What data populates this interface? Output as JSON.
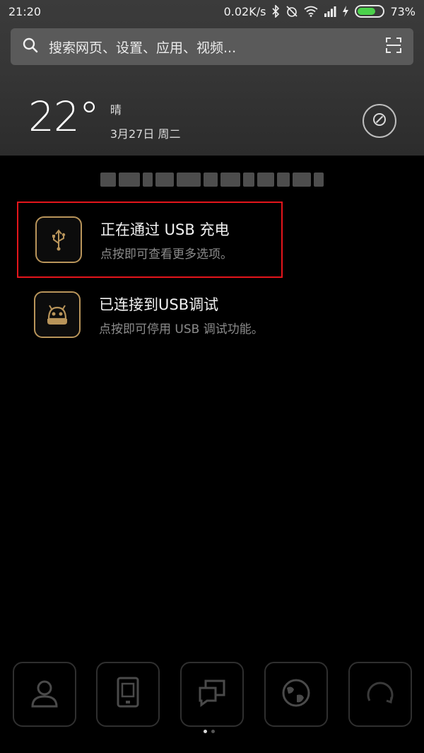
{
  "status_bar": {
    "time": "21:20",
    "speed": "0.02K/s",
    "battery": "73%",
    "battery_level": 0.73,
    "icons": [
      "bluetooth-icon",
      "alarm-off-icon",
      "wifi-icon",
      "signal-icon",
      "charging-icon",
      "battery-icon"
    ]
  },
  "search": {
    "placeholder": "搜索网页、设置、应用、视频...",
    "icons": [
      "search-icon",
      "scan-icon"
    ]
  },
  "weather": {
    "temperature": "22°",
    "condition": "晴",
    "date": "3月27日 周二"
  },
  "notifications": [
    {
      "title": "正在通过 USB 充电",
      "subtitle": "点按即可查看更多选项。",
      "icon": "usb-icon",
      "highlighted": true
    },
    {
      "title": "已连接到USB调试",
      "subtitle": "点按即可停用 USB 调试功能。",
      "icon": "android-debug-icon",
      "highlighted": false
    }
  ],
  "dock": {
    "items": [
      "contacts-icon",
      "phone-frame-icon",
      "messages-icon",
      "browser-icon",
      "refresh-icon"
    ]
  },
  "page_indicator": {
    "count": 2,
    "active": 1
  },
  "colors": {
    "highlight_border": "#e4151b",
    "icon_gold": "#b8945a",
    "battery_fill": "#4bd14b"
  }
}
